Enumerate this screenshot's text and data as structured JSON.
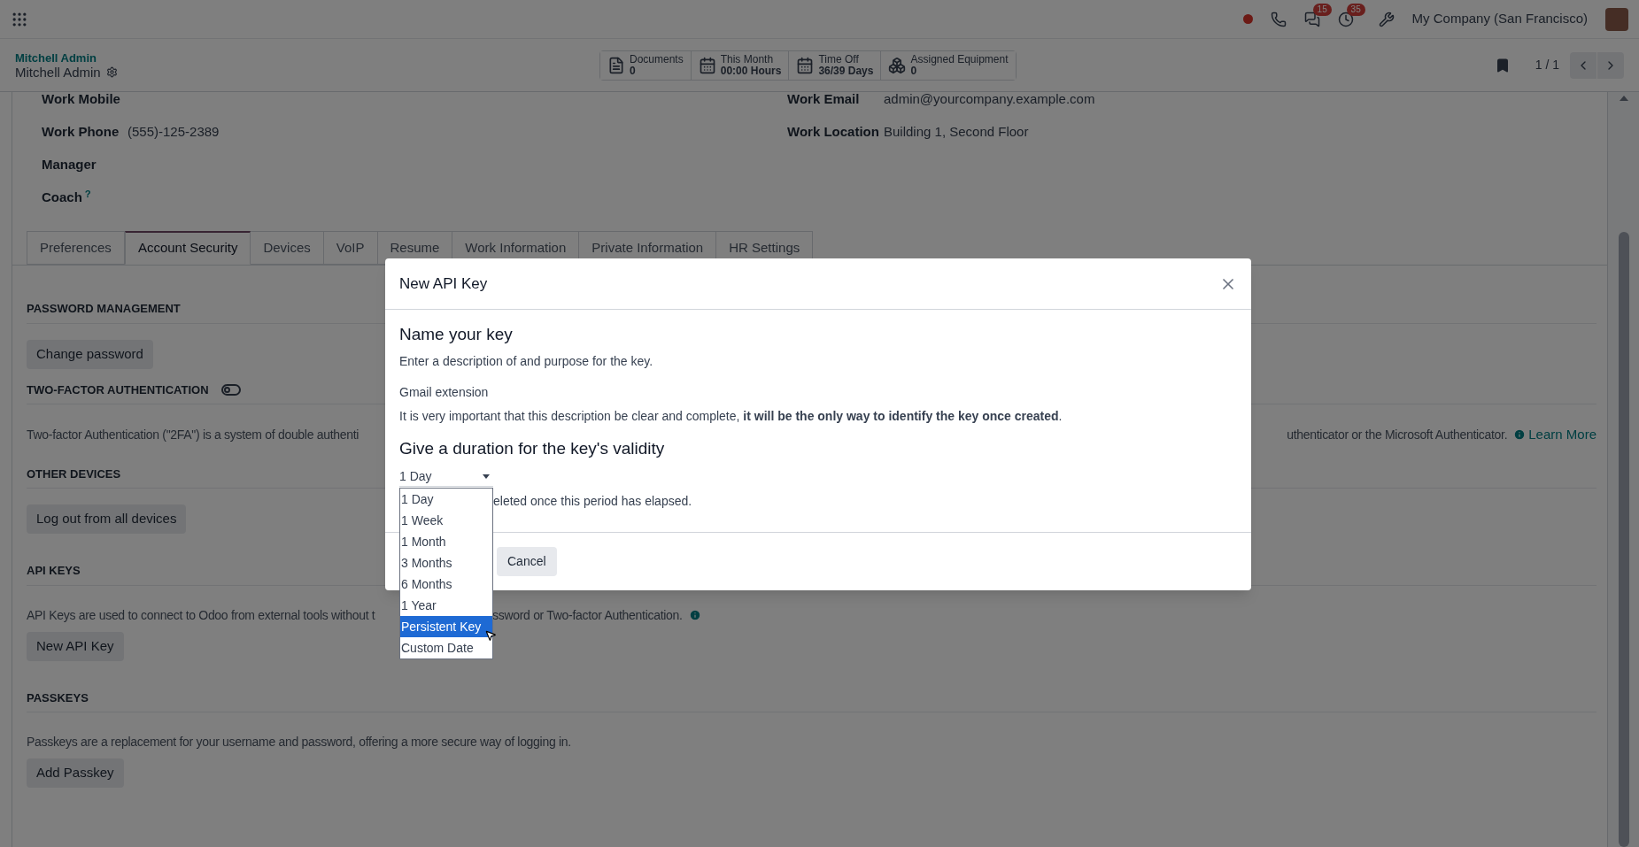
{
  "top_bar": {
    "notifications": [
      {
        "kind": "chat",
        "count": "15"
      },
      {
        "kind": "activity",
        "count": "35"
      }
    ],
    "company": "My Company (San Francisco)"
  },
  "control_panel": {
    "breadcrumb": "Mitchell Admin",
    "record_title": "Mitchell Admin",
    "pager": "1 / 1",
    "stat_buttons": [
      {
        "kind": "document",
        "label": "Documents",
        "value": "0"
      },
      {
        "kind": "calendar",
        "label": "This Month",
        "value": "00:00 Hours"
      },
      {
        "kind": "calendar",
        "label": "Time Off",
        "value": "36/39 Days"
      },
      {
        "kind": "equipment",
        "label": "Assigned Equipment",
        "value": "0"
      }
    ]
  },
  "fields_left": [
    {
      "label": "Work Mobile"
    },
    {
      "label": "Work Phone",
      "value": "(555)-125-2389"
    },
    {
      "label": "Manager"
    },
    {
      "label": "Coach",
      "help": "?"
    }
  ],
  "fields_right": [
    {
      "label": "Work Email",
      "value": "admin@yourcompany.example.com"
    },
    {
      "label": "Work Location",
      "value": "Building 1, Second Floor"
    }
  ],
  "tabs": [
    {
      "label": "Preferences",
      "selected": false
    },
    {
      "label": "Account Security",
      "selected": true
    },
    {
      "label": "Devices",
      "selected": false
    },
    {
      "label": "VoIP",
      "selected": false
    },
    {
      "label": "Resume",
      "selected": false
    },
    {
      "label": "Work Information",
      "selected": false
    },
    {
      "label": "Private Information",
      "selected": false
    },
    {
      "label": "HR Settings",
      "selected": false
    }
  ],
  "sections": [
    {
      "heading": "PASSWORD MANAGEMENT",
      "button": "Change password"
    },
    {
      "heading": "TWO-FACTOR AUTHENTICATION",
      "toggle_on": false,
      "text_start": "Two-factor Authentication (\"2FA\") is a system of double authenti",
      "text_end": "uthenticator or the Microsoft Authenticator.",
      "link": "Learn More"
    },
    {
      "heading": "OTHER DEVICES",
      "button": "Log out from all devices"
    },
    {
      "heading": "API KEYS",
      "text_start": "API Keys are used to connect to Odoo from external tools without t",
      "text_end": "ssword or Two-factor Authentication.",
      "info": true,
      "button": "New API Key"
    },
    {
      "heading": "PASSKEYS",
      "text_start": "Passkeys are a replacement for your username and password, offering a more secure way of logging in.",
      "button": "Add Passkey"
    }
  ],
  "modal": {
    "title": "New API Key",
    "name_heading": "Name your key",
    "name_description": "Enter a description of and purpose for the key.",
    "name_value": "Gmail extension",
    "warning": "It is very important that this description be clear and complete, **it will be the only way to identify the key once created**.",
    "duration_heading": "Give a duration for the key's validity",
    "duration_value": "1 Day",
    "duration_help": "eleted once this period has elapsed.",
    "cancel": "Cancel",
    "options": [
      {
        "label": "1 Day",
        "highlighted": false
      },
      {
        "label": "1 Week",
        "highlighted": false
      },
      {
        "label": "1 Month",
        "highlighted": false
      },
      {
        "label": "3 Months",
        "highlighted": false
      },
      {
        "label": "6 Months",
        "highlighted": false
      },
      {
        "label": "1 Year",
        "highlighted": false
      },
      {
        "label": "Persistent Key",
        "highlighted": true
      },
      {
        "label": "Custom Date",
        "highlighted": false
      }
    ]
  }
}
